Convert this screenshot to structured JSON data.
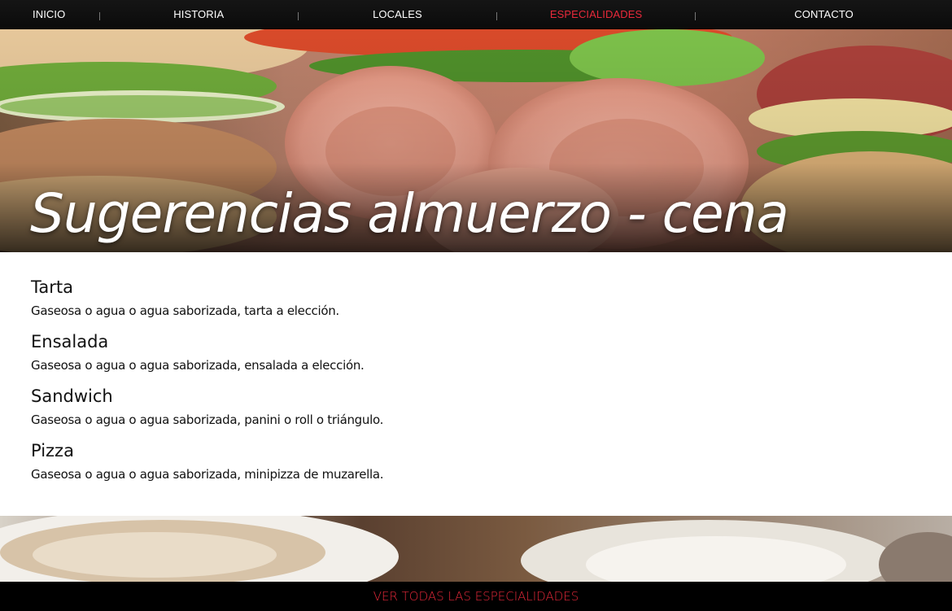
{
  "nav": {
    "items": [
      {
        "label": "INICIO",
        "active": false
      },
      {
        "label": "HISTORIA",
        "active": false
      },
      {
        "label": "LOCALES",
        "active": false
      },
      {
        "label": "ESPECIALIDADES",
        "active": true
      },
      {
        "label": "CONTACTO",
        "active": false
      }
    ]
  },
  "hero": {
    "title": "Sugerencias almuerzo - cena",
    "image": "sandwich-ham-photo"
  },
  "menu": {
    "items": [
      {
        "name": "Tarta",
        "description": "Gaseosa o agua o agua saborizada, tarta a elección."
      },
      {
        "name": "Ensalada",
        "description": "Gaseosa o agua o agua saborizada, ensalada a elección."
      },
      {
        "name": "Sandwich",
        "description": "Gaseosa o agua o agua saborizada, panini o roll o triángulo."
      },
      {
        "name": "Pizza",
        "description": "Gaseosa o agua o agua saborizada, minipizza de muzarella."
      }
    ]
  },
  "strip": {
    "image": "coffee-cups-photo"
  },
  "footer": {
    "link_label": "VER TODAS LAS ESPECIALIDADES"
  },
  "colors": {
    "accent": "#e8293a",
    "nav_bg": "#111111",
    "content_bg": "#ffffff",
    "text": "#111111"
  }
}
